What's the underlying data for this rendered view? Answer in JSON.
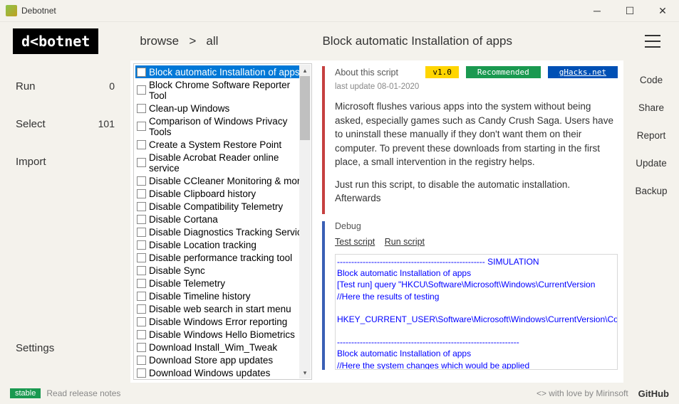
{
  "window": {
    "title": "Debotnet"
  },
  "logo": "d<botnet",
  "breadcrumb": {
    "browse": "browse",
    "sep": ">",
    "all": "all"
  },
  "headerTitle": "Block automatic Installation of apps",
  "nav": {
    "run": {
      "label": "Run",
      "count": "0"
    },
    "select": {
      "label": "Select",
      "count": "101"
    },
    "import": {
      "label": "Import"
    },
    "settings": {
      "label": "Settings"
    }
  },
  "scripts": [
    "Block automatic Installation of apps",
    "Block Chrome Software Reporter Tool",
    "Clean-up Windows",
    "Comparison of Windows Privacy Tools",
    "Create a System Restore Point",
    "Disable Acrobat Reader online service",
    "Disable CCleaner Monitoring & more",
    "Disable Clipboard history",
    "Disable Compatibility Telemetry",
    "Disable Cortana",
    "Disable Diagnostics Tracking Service",
    "Disable Location tracking",
    "Disable performance tracking tool",
    "Disable Sync",
    "Disable Telemetry",
    "Disable Timeline history",
    "Disable web search in start menu",
    "Disable Windows Error reporting",
    "Disable Windows Hello Biometrics",
    "Download Install_Wim_Tweak",
    "Download Store app updates",
    "Download Windows updates"
  ],
  "about": {
    "title": "About this script",
    "version": "v1.0",
    "recommended": "Recommended",
    "link": "gHacks.net",
    "lastUpdate": "last update 08-01-2020",
    "desc1": "Microsoft flushes various apps into the system without being asked, especially games such as Candy Crush Saga. Users have to uninstall these manually if they don't want them on their computer. To prevent these downloads from starting in the first place, a small intervention in the registry helps.",
    "desc2": "Just run this script, to disable the automatic installation. Afterwards"
  },
  "debug": {
    "title": "Debug",
    "test": "Test script",
    "run": "Run script",
    "console": "---------------------------------------------------- SIMULATION\nBlock automatic Installation of apps\n[Test run] query \"HKCU\\Software\\Microsoft\\Windows\\CurrentVersion\n//Here the results of testing\n\nHKEY_CURRENT_USER\\Software\\Microsoft\\Windows\\CurrentVersion\\Cont\n\n----------------------------------------------------------------\nBlock automatic Installation of apps\n//Here the system changes which would be applied\n[Reg] add \"HKCU\\Software\\Microsoft\\Windows\\CurrentVersion\\Conten",
    "highlight": "----------------------------------------------------------------"
  },
  "rightMenu": [
    "Code",
    "Share",
    "Report",
    "Update",
    "Backup"
  ],
  "footer": {
    "stable": "stable",
    "release": "Read release notes",
    "love": "<>  with love by Mirinsoft",
    "github": "GitHub"
  }
}
